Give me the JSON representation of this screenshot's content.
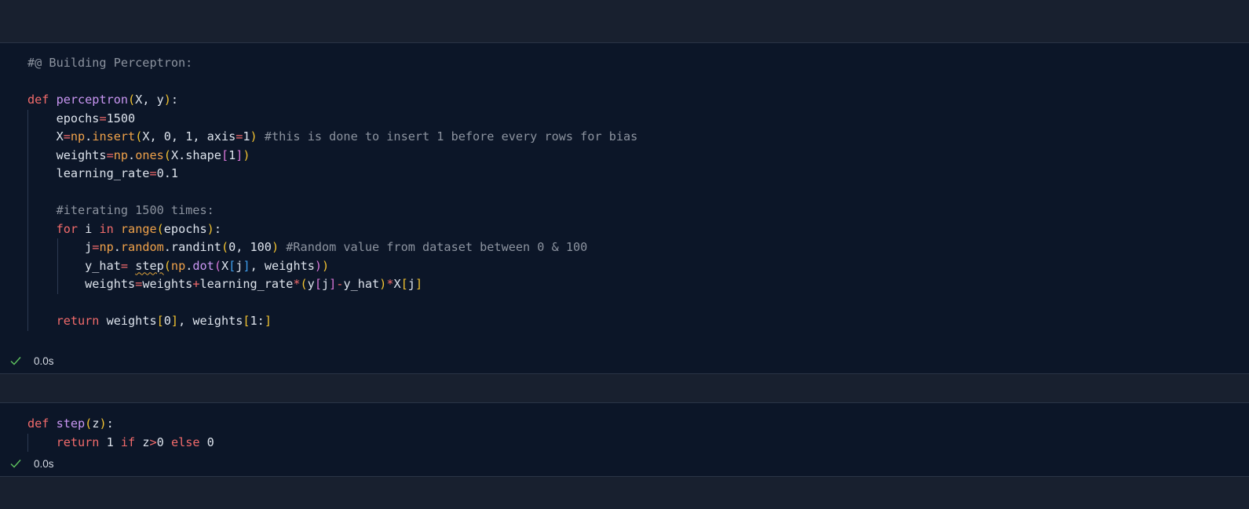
{
  "cells": [
    {
      "lines": [
        [
          {
            "t": "#@ Building Perceptron:",
            "c": "comment"
          }
        ],
        [],
        [
          {
            "t": "def ",
            "c": "kw"
          },
          {
            "t": "perceptron",
            "c": "fn"
          },
          {
            "t": "(",
            "c": "p1"
          },
          {
            "t": "X, y",
            "c": "plain"
          },
          {
            "t": ")",
            "c": "p1"
          },
          {
            "t": ":",
            "c": "plain"
          }
        ],
        [
          {
            "t": "    epochs",
            "c": "plain"
          },
          {
            "t": "=",
            "c": "op"
          },
          {
            "t": "1500",
            "c": "num"
          }
        ],
        [
          {
            "t": "    X",
            "c": "plain"
          },
          {
            "t": "=",
            "c": "op"
          },
          {
            "t": "np",
            "c": "mod"
          },
          {
            "t": ".",
            "c": "plain"
          },
          {
            "t": "insert",
            "c": "builtin"
          },
          {
            "t": "(",
            "c": "p1"
          },
          {
            "t": "X, 0, 1, axis",
            "c": "plain"
          },
          {
            "t": "=",
            "c": "op"
          },
          {
            "t": "1",
            "c": "num"
          },
          {
            "t": ")",
            "c": "p1"
          },
          {
            "t": " #this is done to insert 1 before every rows for bias",
            "c": "comment"
          }
        ],
        [
          {
            "t": "    weights",
            "c": "plain"
          },
          {
            "t": "=",
            "c": "op"
          },
          {
            "t": "np",
            "c": "mod"
          },
          {
            "t": ".",
            "c": "plain"
          },
          {
            "t": "ones",
            "c": "builtin"
          },
          {
            "t": "(",
            "c": "p1"
          },
          {
            "t": "X.shape",
            "c": "plain"
          },
          {
            "t": "[",
            "c": "p2"
          },
          {
            "t": "1",
            "c": "num"
          },
          {
            "t": "]",
            "c": "p2"
          },
          {
            "t": ")",
            "c": "p1"
          }
        ],
        [
          {
            "t": "    learning_rate",
            "c": "plain"
          },
          {
            "t": "=",
            "c": "op"
          },
          {
            "t": "0.1",
            "c": "num"
          }
        ],
        [],
        [
          {
            "t": "    #iterating 1500 times:",
            "c": "comment"
          }
        ],
        [
          {
            "t": "    ",
            "c": "plain"
          },
          {
            "t": "for",
            "c": "kw"
          },
          {
            "t": " i ",
            "c": "plain"
          },
          {
            "t": "in",
            "c": "kw"
          },
          {
            "t": " ",
            "c": "plain"
          },
          {
            "t": "range",
            "c": "builtin"
          },
          {
            "t": "(",
            "c": "p1"
          },
          {
            "t": "epochs",
            "c": "plain"
          },
          {
            "t": ")",
            "c": "p1"
          },
          {
            "t": ":",
            "c": "plain"
          }
        ],
        [
          {
            "t": "        j",
            "c": "plain"
          },
          {
            "t": "=",
            "c": "op"
          },
          {
            "t": "np",
            "c": "mod"
          },
          {
            "t": ".",
            "c": "plain"
          },
          {
            "t": "random",
            "c": "mod"
          },
          {
            "t": ".randint",
            "c": "plain"
          },
          {
            "t": "(",
            "c": "p1"
          },
          {
            "t": "0, 100",
            "c": "plain"
          },
          {
            "t": ")",
            "c": "p1"
          },
          {
            "t": " #Random value from dataset between 0 & 100",
            "c": "comment"
          }
        ],
        [
          {
            "t": "        y_hat",
            "c": "plain"
          },
          {
            "t": "=",
            "c": "op"
          },
          {
            "t": " ",
            "c": "plain"
          },
          {
            "t": "step",
            "c": "plain",
            "squiggle": true
          },
          {
            "t": "(",
            "c": "p1"
          },
          {
            "t": "np",
            "c": "mod"
          },
          {
            "t": ".",
            "c": "plain"
          },
          {
            "t": "dot",
            "c": "fn"
          },
          {
            "t": "(",
            "c": "p2"
          },
          {
            "t": "X",
            "c": "plain"
          },
          {
            "t": "[",
            "c": "p3"
          },
          {
            "t": "j",
            "c": "plain"
          },
          {
            "t": "]",
            "c": "p3"
          },
          {
            "t": ", weights",
            "c": "plain"
          },
          {
            "t": ")",
            "c": "p2"
          },
          {
            "t": ")",
            "c": "p1"
          }
        ],
        [
          {
            "t": "        weights",
            "c": "plain"
          },
          {
            "t": "=",
            "c": "op"
          },
          {
            "t": "weights",
            "c": "plain"
          },
          {
            "t": "+",
            "c": "op"
          },
          {
            "t": "learning_rate",
            "c": "plain"
          },
          {
            "t": "*",
            "c": "op"
          },
          {
            "t": "(",
            "c": "p1"
          },
          {
            "t": "y",
            "c": "plain"
          },
          {
            "t": "[",
            "c": "p2"
          },
          {
            "t": "j",
            "c": "plain"
          },
          {
            "t": "]",
            "c": "p2"
          },
          {
            "t": "-",
            "c": "op"
          },
          {
            "t": "y_hat",
            "c": "plain"
          },
          {
            "t": ")",
            "c": "p1"
          },
          {
            "t": "*",
            "c": "op"
          },
          {
            "t": "X",
            "c": "plain"
          },
          {
            "t": "[",
            "c": "p1"
          },
          {
            "t": "j",
            "c": "plain"
          },
          {
            "t": "]",
            "c": "p1"
          }
        ],
        [],
        [
          {
            "t": "    ",
            "c": "plain"
          },
          {
            "t": "return",
            "c": "kw"
          },
          {
            "t": " weights",
            "c": "plain"
          },
          {
            "t": "[",
            "c": "p1"
          },
          {
            "t": "0",
            "c": "num"
          },
          {
            "t": "]",
            "c": "p1"
          },
          {
            "t": ", weights",
            "c": "plain"
          },
          {
            "t": "[",
            "c": "p1"
          },
          {
            "t": "1:",
            "c": "plain"
          },
          {
            "t": "]",
            "c": "p1"
          }
        ]
      ],
      "guides": [
        0,
        0,
        0,
        1,
        1,
        1,
        1,
        1,
        1,
        1,
        2,
        2,
        2,
        1,
        1
      ],
      "status": {
        "icon": "check-icon",
        "time": "0.0s"
      }
    },
    {
      "lines": [
        [
          {
            "t": "def ",
            "c": "kw"
          },
          {
            "t": "step",
            "c": "fn"
          },
          {
            "t": "(",
            "c": "p1"
          },
          {
            "t": "z",
            "c": "plain"
          },
          {
            "t": ")",
            "c": "p1"
          },
          {
            "t": ":",
            "c": "plain"
          }
        ],
        [
          {
            "t": "    ",
            "c": "plain"
          },
          {
            "t": "return",
            "c": "kw"
          },
          {
            "t": " 1 ",
            "c": "plain"
          },
          {
            "t": "if",
            "c": "kw"
          },
          {
            "t": " z",
            "c": "plain"
          },
          {
            "t": ">",
            "c": "op"
          },
          {
            "t": "0 ",
            "c": "num"
          },
          {
            "t": "else",
            "c": "kw"
          },
          {
            "t": " 0",
            "c": "num"
          }
        ]
      ],
      "guides": [
        0,
        1
      ],
      "status": {
        "icon": "check-icon",
        "time": "0.0s"
      }
    }
  ],
  "colors": {
    "background": "#18202f",
    "cell_background": "#0c1628",
    "check": "#5fc45f"
  }
}
